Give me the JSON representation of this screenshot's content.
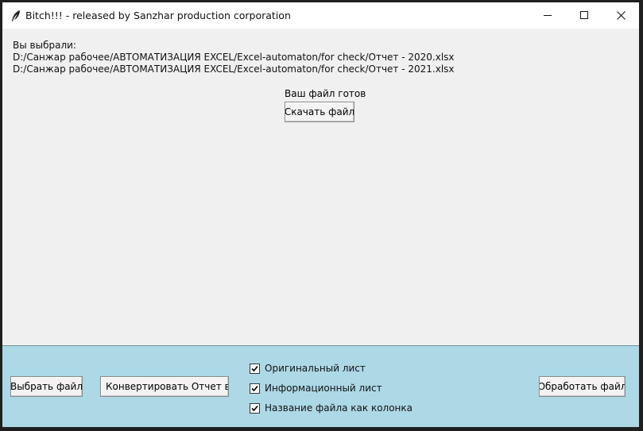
{
  "window": {
    "title": "Bitch!!! - released by Sanzhar production corporation",
    "icon": "feather-icon",
    "controls": [
      "minimize-icon",
      "maximize-icon",
      "close-icon"
    ]
  },
  "selection": {
    "heading": "Вы выбрали:",
    "files": [
      "D:/Санжар рабочее/АВТОМАТИЗАЦИЯ EXCEL/Excel-automaton/for check/Отчет - 2020.xlsx",
      "D:/Санжар рабочее/АВТОМАТИЗАЦИЯ EXCEL/Excel-automaton/for check/Отчет - 2021.xlsx"
    ]
  },
  "result": {
    "status": "Ваш файл готов",
    "download_label": "Скачать файл"
  },
  "controls": {
    "select_label": "Выбрать файл",
    "convert_label": "Конвертировать Отчет в таб",
    "process_label": "Обработать файл",
    "options": [
      {
        "label": "Оригинальный лист",
        "checked": true
      },
      {
        "label": "Информационный лист",
        "checked": true
      },
      {
        "label": "Название файла как колонка",
        "checked": true
      }
    ]
  },
  "colors": {
    "panel_bg": "#add8e6",
    "window_bg": "#f0f0f0"
  }
}
